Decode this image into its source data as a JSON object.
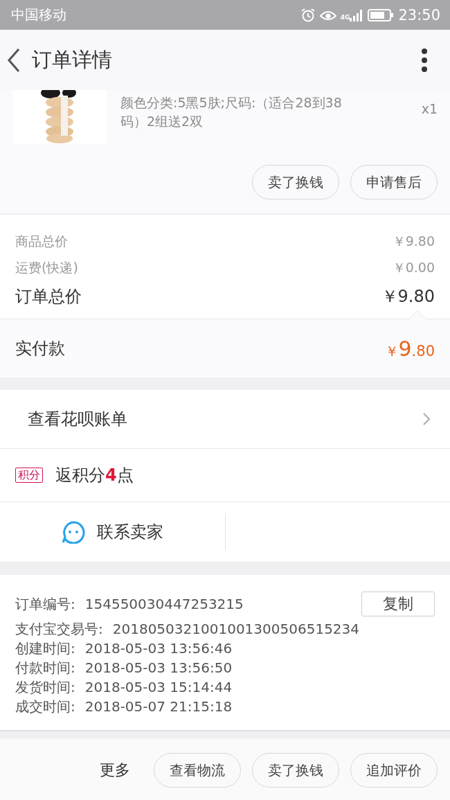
{
  "status_bar": {
    "carrier": "中国移动",
    "network": "4G",
    "time": "23:50"
  },
  "header": {
    "title": "订单详情"
  },
  "product": {
    "spec": "颜色分类:5黑5肤;尺码:（适合28到38码）2组送2双",
    "quantity": "x1"
  },
  "item_actions": [
    "卖了换钱",
    "申请售后"
  ],
  "totals": [
    {
      "label": "商品总价",
      "value": "￥9.80",
      "kind": "minor"
    },
    {
      "label": "运费(快递)",
      "value": "￥0.00",
      "kind": "minor"
    },
    {
      "label": "订单总价",
      "value": "￥9.80",
      "kind": "major"
    }
  ],
  "paid": {
    "label": "实付款",
    "currency": "￥",
    "integer": "9",
    "decimal": ".80"
  },
  "huabei": {
    "label": "查看花呗账单"
  },
  "points": {
    "badge": "积分",
    "text": "返积分**4**点"
  },
  "contact": {
    "label": "联系卖家"
  },
  "order_info": [
    {
      "label": "订单编号:",
      "value": "154550030447253215",
      "copy": "复制"
    },
    {
      "label": "支付宝交易号:",
      "value": "2018050321001001300506515234"
    },
    {
      "label": "创建时间:",
      "value": "2018-05-03 13:56:46"
    },
    {
      "label": "付款时间:",
      "value": "2018-05-03 13:56:50"
    },
    {
      "label": "发货时间:",
      "value": "2018-05-03 15:14:44"
    },
    {
      "label": "成交时间:",
      "value": "2018-05-07 21:15:18"
    }
  ],
  "bottom_bar": {
    "more": "更多",
    "buttons": [
      "查看物流",
      "卖了换钱",
      "追加评价"
    ]
  }
}
